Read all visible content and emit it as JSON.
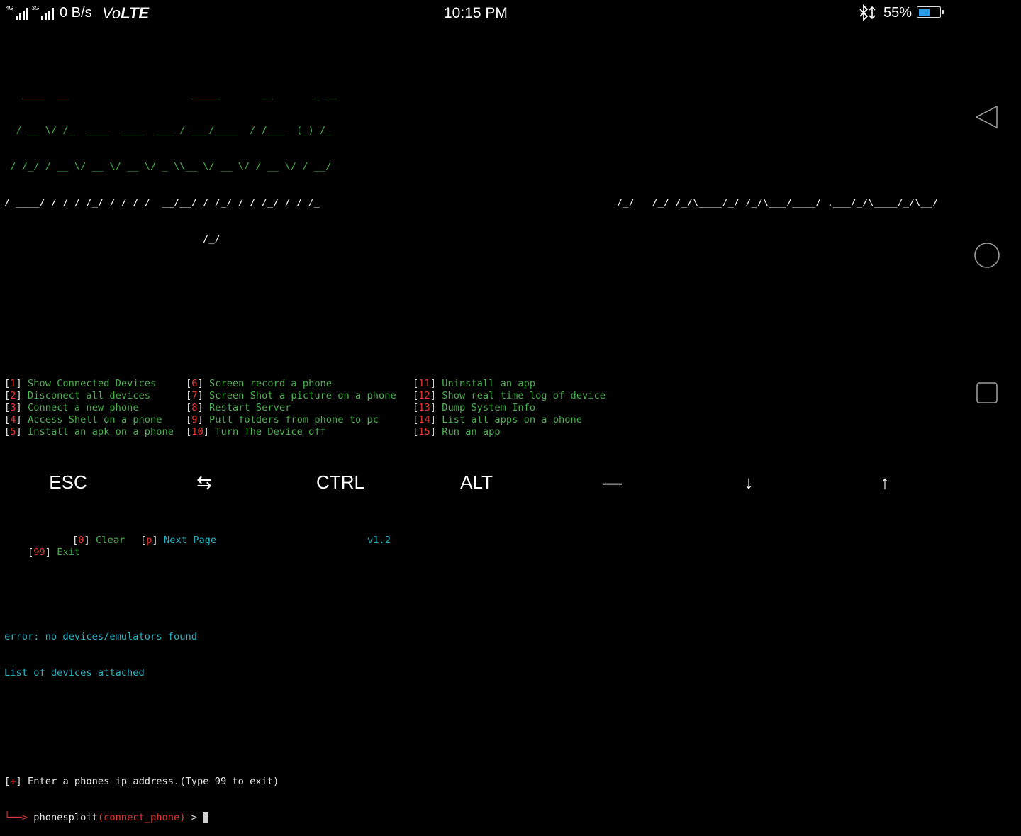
{
  "status_bar": {
    "net_tag_1": "4G",
    "net_tag_2": "3G",
    "speed": "0 B/s",
    "volte_vo": "Vo",
    "volte_lte": "LTE",
    "time": "10:15 PM",
    "battery_percent": "55%",
    "battery_level": 0.55,
    "battery_color": "#2e9be8"
  },
  "banner": {
    "line1": "   ____  __                     _____       __       _ __ ",
    "line2": "  / __ \\/ /_  ____  ____  ___ / ___/____  / /___  (_) /_",
    "line3": " / /_/ / __ \\/ __ \\/ __ \\/ _ \\\\__ \\/ __ \\/ / __ \\/ / __/",
    "line4a": "/ ____/ / / / /_/ / / / /  __/__/ / /_/ / / /_/ / / /_  ",
    "line4b": "/_/   /_/ /_/\\____/_/ /_/\\___/____/ .___/_/\\____/_/\\__/  ",
    "line5": "                                  /_/"
  },
  "menu": {
    "col1": [
      {
        "num": "1",
        "label": "Show Connected Devices"
      },
      {
        "num": "2",
        "label": "Disconect all devices"
      },
      {
        "num": "3",
        "label": "Connect a new phone"
      },
      {
        "num": "4",
        "label": "Access Shell on a phone"
      },
      {
        "num": "5",
        "label": "Install an apk on a phone"
      }
    ],
    "col2": [
      {
        "num": "6",
        "label": "Screen record a phone"
      },
      {
        "num": "7",
        "label": "Screen Shot a picture on a phone"
      },
      {
        "num": "8",
        "label": "Restart Server"
      },
      {
        "num": "9",
        "label": "Pull folders from phone to pc"
      },
      {
        "num": "10",
        "label": "Turn The Device off"
      }
    ],
    "col3": [
      {
        "num": "11",
        "label": "Uninstall an app"
      },
      {
        "num": "12",
        "label": "Show real time log of device"
      },
      {
        "num": "13",
        "label": "Dump System Info"
      },
      {
        "num": "14",
        "label": "List all apps on a phone"
      },
      {
        "num": "15",
        "label": "Run an app"
      }
    ]
  },
  "footer_menu": {
    "exit_num": "99",
    "exit_label": "Exit",
    "clear_num": "0",
    "clear_label": "Clear",
    "next_num": "p",
    "next_label": "Next Page",
    "version": "v1.2"
  },
  "output": {
    "error": "error: no devices/emulators found",
    "list": "List of devices attached"
  },
  "prompt": {
    "marker": "+",
    "message": "Enter a phones ip address.(Type 99 to exit)",
    "arrow": "└──>",
    "program": "phonesploit",
    "context": "(connect_phone)",
    "symbol": ">"
  },
  "nav_icons": [
    "back-icon",
    "home-icon",
    "recents-icon"
  ],
  "extra_keys": {
    "esc": "ESC",
    "tab": "⇆",
    "ctrl": "CTRL",
    "alt": "ALT",
    "dash": "—",
    "down": "↓",
    "up": "↑"
  },
  "colors": {
    "green": "#4caf50",
    "cyan": "#29b6c6",
    "red": "#e53935"
  }
}
